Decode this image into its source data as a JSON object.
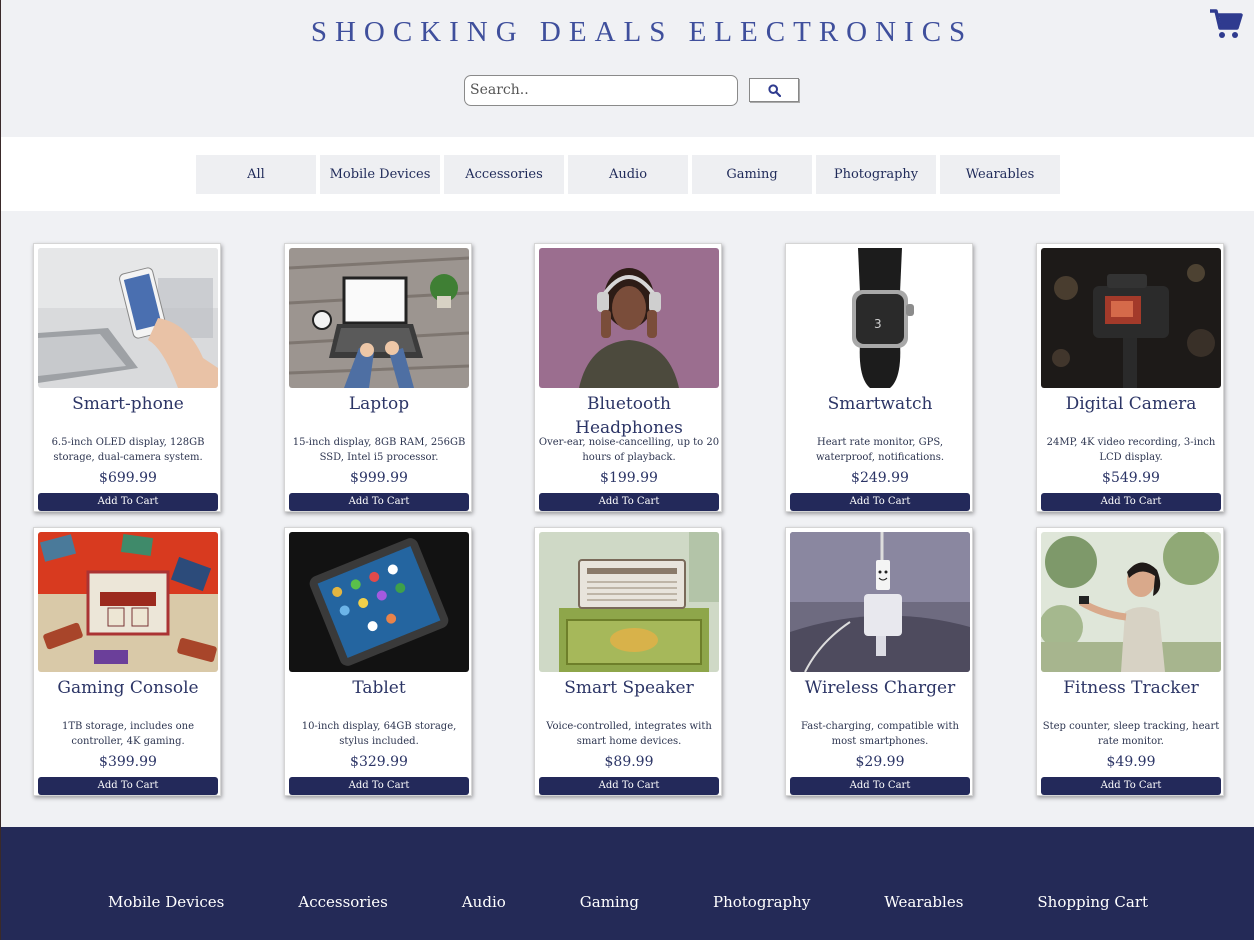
{
  "brand": "SHOCKING DEALS ELECTRONICS",
  "cart_icon": "shopping-cart-icon",
  "search": {
    "placeholder": "Search..",
    "button_icon": "search-icon"
  },
  "categories": [
    "All",
    "Mobile Devices",
    "Accessories",
    "Audio",
    "Gaming",
    "Photography",
    "Wearables"
  ],
  "add_label": "Add To Cart",
  "products": [
    {
      "name": "Smart-phone",
      "desc": "6.5-inch OLED display, 128GB storage, dual-camera system.",
      "price": "$699.99",
      "image": "smartphone-photo"
    },
    {
      "name": "Laptop",
      "desc": "15-inch display, 8GB RAM, 256GB SSD, Intel i5 processor.",
      "price": "$999.99",
      "image": "laptop-photo"
    },
    {
      "name": "Bluetooth Headphones",
      "desc": "Over-ear, noise-cancelling, up to 20 hours of playback.",
      "price": "$199.99",
      "image": "headphones-photo"
    },
    {
      "name": "Smartwatch",
      "desc": "Heart rate monitor, GPS, waterproof, notifications.",
      "price": "$249.99",
      "image": "smartwatch-photo"
    },
    {
      "name": "Digital Camera",
      "desc": "24MP, 4K video recording, 3-inch LCD display.",
      "price": "$549.99",
      "image": "camera-photo"
    },
    {
      "name": "Gaming Console",
      "desc": "1TB storage, includes one controller, 4K gaming.",
      "price": "$399.99",
      "image": "console-photo"
    },
    {
      "name": "Tablet",
      "desc": "10-inch display, 64GB storage, stylus included.",
      "price": "$329.99",
      "image": "tablet-photo"
    },
    {
      "name": "Smart Speaker",
      "desc": "Voice-controlled, integrates with smart home devices.",
      "price": "$89.99",
      "image": "speaker-photo"
    },
    {
      "name": "Wireless Charger",
      "desc": "Fast-charging, compatible with most smartphones.",
      "price": "$29.99",
      "image": "charger-photo"
    },
    {
      "name": "Fitness Tracker",
      "desc": "Step counter, sleep tracking, heart rate monitor.",
      "price": "$49.99",
      "image": "fitness-photo"
    }
  ],
  "footer": [
    "Mobile Devices",
    "Accessories",
    "Audio",
    "Gaming",
    "Photography",
    "Wearables",
    "Shopping Cart"
  ],
  "colors": {
    "brand": "#3f4f9c",
    "button": "#23295a",
    "footer": "#242a57"
  }
}
